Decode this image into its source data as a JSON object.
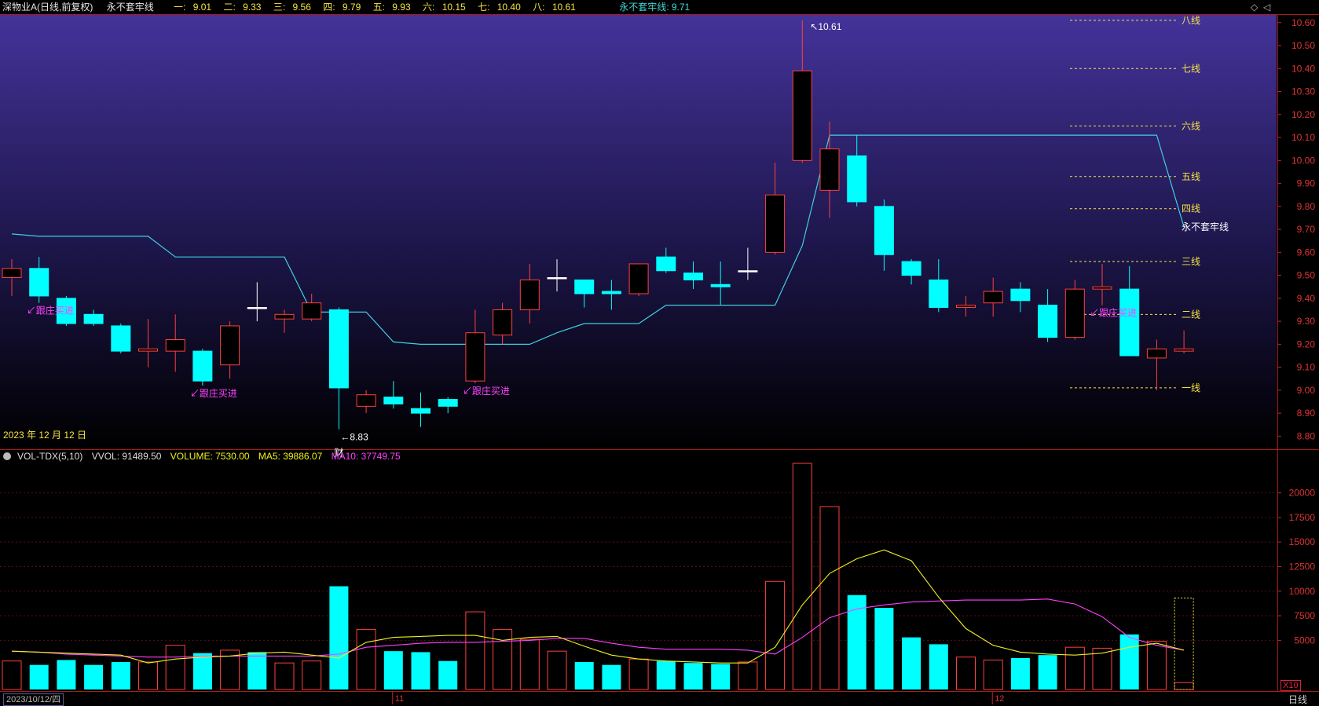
{
  "header": {
    "title": "深物业A(日线,前复权)",
    "indicator_name": "永不套牢线",
    "levels": [
      {
        "label": "一:",
        "value": "9.01"
      },
      {
        "label": "二:",
        "value": "9.33"
      },
      {
        "label": "三:",
        "value": "9.56"
      },
      {
        "label": "四:",
        "value": "9.79"
      },
      {
        "label": "五:",
        "value": "9.93"
      },
      {
        "label": "六:",
        "value": "10.15"
      },
      {
        "label": "七:",
        "value": "10.40"
      },
      {
        "label": "八:",
        "value": "10.61"
      }
    ],
    "yb_label": "永不套牢线: 9.71"
  },
  "price_panel": {
    "date_label": "2023 年 12 月 12 日",
    "y_ticks": [
      "10.60",
      "10.50",
      "10.40",
      "10.30",
      "10.20",
      "10.10",
      "10.00",
      "9.90",
      "9.80",
      "9.70",
      "9.60",
      "9.50",
      "9.40",
      "9.30",
      "9.20",
      "9.10",
      "9.00",
      "8.90",
      "8.80"
    ],
    "max_label": "10.61",
    "min_label": "8.83",
    "min_marker": "财",
    "line_labels": [
      {
        "label": "八线",
        "value": 10.61
      },
      {
        "label": "七线",
        "value": 10.4
      },
      {
        "label": "六线",
        "value": 10.15
      },
      {
        "label": "五线",
        "value": 9.93
      },
      {
        "label": "四线",
        "value": 9.79
      },
      {
        "label": "三线",
        "value": 9.56
      },
      {
        "label": "二线",
        "value": 9.33
      },
      {
        "label": "一线",
        "value": 9.01
      }
    ],
    "yb_line_label": "永不套牢线",
    "signal_text": "跟庄买进"
  },
  "volume_panel": {
    "indicator": "VOL-TDX(5,10)",
    "vvol": "VVOL: 91489.50",
    "volume": "VOLUME: 7530.00",
    "ma5": "MA5: 39886.07",
    "ma10": "MA10: 37749.75",
    "y_ticks": [
      "20000",
      "17500",
      "15000",
      "12500",
      "10000",
      "7500",
      "5000"
    ],
    "scale_badge": "X10"
  },
  "x_axis": {
    "start_date": "2023/10/12/四",
    "month_labels": [
      "11",
      "12"
    ],
    "period": "日线"
  },
  "colors": {
    "up": "#ff4040",
    "down": "#00ffff",
    "yb_line": "#3fd0e0",
    "level_line": "#f5e342",
    "ma5": "#f0f020",
    "ma10": "#ff40ff",
    "signal": "#ff40ff"
  },
  "chart_data": {
    "type": "candlestick",
    "candles": [
      {
        "o": 9.49,
        "c": 9.53,
        "h": 9.57,
        "l": 9.41
      },
      {
        "o": 9.53,
        "c": 9.41,
        "h": 9.58,
        "l": 9.38
      },
      {
        "o": 9.4,
        "c": 9.29,
        "h": 9.41,
        "l": 9.28
      },
      {
        "o": 9.33,
        "c": 9.29,
        "h": 9.35,
        "l": 9.28
      },
      {
        "o": 9.28,
        "c": 9.17,
        "h": 9.29,
        "l": 9.16
      },
      {
        "o": 9.17,
        "c": 9.18,
        "h": 9.31,
        "l": 9.1
      },
      {
        "o": 9.17,
        "c": 9.22,
        "h": 9.33,
        "l": 9.08
      },
      {
        "o": 9.17,
        "c": 9.04,
        "h": 9.18,
        "l": 9.02
      },
      {
        "o": 9.11,
        "c": 9.28,
        "h": 9.3,
        "l": 9.05
      },
      {
        "o": 9.36,
        "c": 9.36,
        "h": 9.47,
        "l": 9.3
      },
      {
        "o": 9.31,
        "c": 9.33,
        "h": 9.35,
        "l": 9.25
      },
      {
        "o": 9.31,
        "c": 9.38,
        "h": 9.42,
        "l": 9.3
      },
      {
        "o": 9.35,
        "c": 9.01,
        "h": 9.36,
        "l": 8.83
      },
      {
        "o": 8.93,
        "c": 8.98,
        "h": 9.0,
        "l": 8.9
      },
      {
        "o": 8.97,
        "c": 8.94,
        "h": 9.04,
        "l": 8.92
      },
      {
        "o": 8.92,
        "c": 8.9,
        "h": 8.99,
        "l": 8.84
      },
      {
        "o": 8.96,
        "c": 8.93,
        "h": 8.97,
        "l": 8.9
      },
      {
        "o": 9.04,
        "c": 9.25,
        "h": 9.35,
        "l": 9.03
      },
      {
        "o": 9.24,
        "c": 9.35,
        "h": 9.38,
        "l": 9.2
      },
      {
        "o": 9.35,
        "c": 9.48,
        "h": 9.55,
        "l": 9.29
      },
      {
        "o": 9.49,
        "c": 9.49,
        "h": 9.57,
        "l": 9.43
      },
      {
        "o": 9.48,
        "c": 9.42,
        "h": 9.48,
        "l": 9.36
      },
      {
        "o": 9.43,
        "c": 9.42,
        "h": 9.48,
        "l": 9.35
      },
      {
        "o": 9.42,
        "c": 9.55,
        "h": 9.55,
        "l": 9.41
      },
      {
        "o": 9.58,
        "c": 9.52,
        "h": 9.62,
        "l": 9.51
      },
      {
        "o": 9.51,
        "c": 9.48,
        "h": 9.56,
        "l": 9.44
      },
      {
        "o": 9.46,
        "c": 9.45,
        "h": 9.56,
        "l": 9.37
      },
      {
        "o": 9.52,
        "c": 9.52,
        "h": 9.62,
        "l": 9.48
      },
      {
        "o": 9.6,
        "c": 9.85,
        "h": 9.99,
        "l": 9.59
      },
      {
        "o": 10.0,
        "c": 10.39,
        "h": 10.61,
        "l": 9.99
      },
      {
        "o": 9.87,
        "c": 10.05,
        "h": 10.17,
        "l": 9.75
      },
      {
        "o": 10.02,
        "c": 9.82,
        "h": 10.11,
        "l": 9.8
      },
      {
        "o": 9.8,
        "c": 9.59,
        "h": 9.83,
        "l": 9.52
      },
      {
        "o": 9.56,
        "c": 9.5,
        "h": 9.57,
        "l": 9.46
      },
      {
        "o": 9.48,
        "c": 9.36,
        "h": 9.57,
        "l": 9.34
      },
      {
        "o": 9.36,
        "c": 9.37,
        "h": 9.41,
        "l": 9.32
      },
      {
        "o": 9.38,
        "c": 9.43,
        "h": 9.49,
        "l": 9.32
      },
      {
        "o": 9.44,
        "c": 9.39,
        "h": 9.47,
        "l": 9.34
      },
      {
        "o": 9.37,
        "c": 9.23,
        "h": 9.44,
        "l": 9.21
      },
      {
        "o": 9.23,
        "c": 9.44,
        "h": 9.48,
        "l": 9.22
      },
      {
        "o": 9.44,
        "c": 9.45,
        "h": 9.55,
        "l": 9.37
      },
      {
        "o": 9.44,
        "c": 9.15,
        "h": 9.54,
        "l": 9.15
      },
      {
        "o": 9.14,
        "c": 9.18,
        "h": 9.22,
        "l": 9.0
      },
      {
        "o": 9.17,
        "c": 9.18,
        "h": 9.26,
        "l": 9.16
      }
    ],
    "yb_line": [
      9.68,
      9.67,
      9.67,
      9.67,
      9.67,
      9.67,
      9.58,
      9.58,
      9.58,
      9.58,
      9.58,
      9.34,
      9.34,
      9.34,
      9.21,
      9.2,
      9.2,
      9.2,
      9.2,
      9.2,
      9.25,
      9.29,
      9.29,
      9.29,
      9.37,
      9.37,
      9.37,
      9.37,
      9.37,
      9.63,
      10.11,
      10.11,
      10.11,
      10.11,
      10.11,
      10.11,
      10.11,
      10.11,
      10.11,
      10.11,
      10.11,
      10.11,
      10.11,
      9.71
    ],
    "signals": [
      1,
      7,
      17,
      40
    ],
    "volume": [
      2900,
      2500,
      3000,
      2500,
      2800,
      2800,
      4500,
      3700,
      4000,
      3800,
      2700,
      2900,
      10500,
      6100,
      3900,
      3800,
      2900,
      7900,
      6100,
      5100,
      3900,
      2800,
      2500,
      3100,
      2900,
      2700,
      2600,
      2800,
      11000,
      23000,
      18600,
      9600,
      8300,
      5300,
      4600,
      3300,
      3000,
      3200,
      3500,
      4300,
      4200,
      5600,
      4900,
      700
    ],
    "vol_down": [
      false,
      true,
      true,
      true,
      true,
      false,
      false,
      true,
      false,
      true,
      false,
      false,
      true,
      false,
      true,
      true,
      true,
      false,
      false,
      false,
      false,
      true,
      true,
      false,
      true,
      true,
      true,
      false,
      false,
      false,
      false,
      true,
      true,
      true,
      true,
      false,
      false,
      true,
      true,
      false,
      false,
      true,
      false,
      false
    ],
    "ma5": [
      3900,
      3800,
      3700,
      3600,
      3500,
      2700,
      3100,
      3300,
      3400,
      3700,
      3800,
      3500,
      3200,
      4800,
      5300,
      5400,
      5500,
      5500,
      5000,
      5300,
      5400,
      4400,
      3500,
      3100,
      2900,
      2800,
      2700,
      2700,
      4300,
      8600,
      11800,
      13300,
      14200,
      13100,
      9400,
      6200,
      4500,
      3800,
      3600,
      3500,
      3700,
      4300,
      4700,
      4000
    ],
    "ma10": [
      3900,
      3800,
      3600,
      3500,
      3400,
      3300,
      3300,
      3400,
      3400,
      3400,
      3400,
      3400,
      3600,
      4300,
      4500,
      4700,
      4800,
      4800,
      4900,
      5000,
      5200,
      5200,
      4700,
      4300,
      4100,
      4100,
      4100,
      4000,
      3600,
      5300,
      7300,
      8200,
      8600,
      8900,
      9000,
      9100,
      9100,
      9100,
      9200,
      8700,
      7400,
      5300,
      4500,
      4000
    ],
    "price_ylim": [
      8.75,
      10.63
    ],
    "volume_ylim": [
      0,
      23000
    ]
  }
}
